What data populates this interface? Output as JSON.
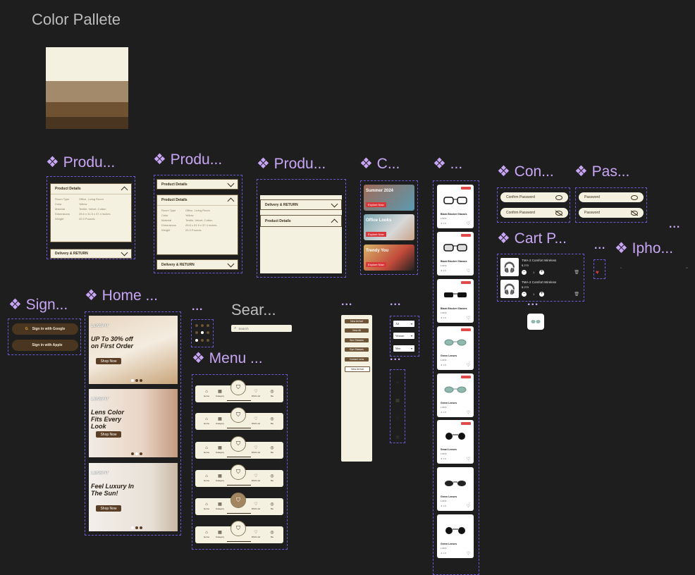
{
  "canvas": {
    "background": "#1e1e1e",
    "accent": "#c8a6f5"
  },
  "palette": {
    "title": "Color Pallete",
    "swatches": [
      "#f5f1e1",
      "#a38a6a",
      "#6e5232",
      "#4a3520"
    ]
  },
  "components": {
    "product1": "❖ Produ...",
    "product2": "❖ Produ...",
    "product3": "❖ Produ...",
    "c": "❖ C...",
    "dots1": "❖ ...",
    "confirm": "❖ Con...",
    "pass": "❖ Pas...",
    "cart": "❖ Cart P...",
    "iphone": "❖ Ipho...",
    "sign": "❖ Sign...",
    "home": "❖ Home ...",
    "menu": "❖ Menu ...",
    "search_title": "Sear...",
    "ellipsis": "..."
  },
  "product_details": {
    "header": "Product Details",
    "delivery": "Delivery & RETURN",
    "specs": [
      {
        "k": "Room Type",
        "v": "Office, Living Room"
      },
      {
        "k": "Color",
        "v": "Yellow"
      },
      {
        "k": "Material",
        "v": "Textile, Velvet, Cotton"
      },
      {
        "k": "Dimensions",
        "v": "25.6 x 31.5 x 37.4 inches"
      },
      {
        "k": "Weight",
        "v": "20.3 Pounds"
      }
    ]
  },
  "banners": [
    {
      "title": "Summer 2024",
      "btn": "Explore Now"
    },
    {
      "title": "Office Looks",
      "btn": "Explore Now"
    },
    {
      "title": "Trendy You",
      "btn": "Explore Now"
    }
  ],
  "products": [
    {
      "name": "Black Blocker Glasses",
      "price": "1.60 $",
      "rating": "★ 4.8"
    },
    {
      "name": "Black Blocker Glasses",
      "price": "1.60 $",
      "rating": "★ 4.8"
    },
    {
      "name": "Black Blocker Glasses",
      "price": "1.60 $",
      "rating": "★ 4.8"
    },
    {
      "name": "Green Lenses",
      "price": "1.60 $",
      "rating": "★ 4.8"
    },
    {
      "name": "Green Lenses",
      "price": "1.60 $",
      "rating": "★ 4.8"
    },
    {
      "name": "Smart Lenses",
      "price": "1.60 $",
      "rating": "★ 4.8"
    },
    {
      "name": "Green Lenses",
      "price": "1.60 $",
      "rating": "★ 4.8"
    },
    {
      "name": "Green Lenses",
      "price": "1.60 $",
      "rating": "★ 4.8"
    }
  ],
  "passwords": {
    "confirm1": "Confirm Password",
    "confirm2": "Confirm Password",
    "pass1": "Password",
    "pass2": "Password"
  },
  "cart": [
    {
      "name": "TMA-2 Comfort Wireless",
      "price": "$ 270",
      "qty": "1"
    },
    {
      "name": "TMA-2 Comfort Wireless",
      "price": "$ 270",
      "qty": "1"
    }
  ],
  "sign_in": {
    "google": "Sign in with Google",
    "apple": "Sign in with Apple"
  },
  "home": [
    {
      "brand": "LENSFIT",
      "headline": "UP To 30% off on First Order",
      "shop": "Shop Now"
    },
    {
      "brand": "LENSFIT",
      "headline": "Lens Color Fits Every Look",
      "shop": "Shop Now"
    },
    {
      "brand": "LENSFIT",
      "headline": "Feel Luxury In The Sun!",
      "shop": "Shop Now"
    }
  ],
  "search": {
    "placeholder": "Search"
  },
  "menu_items": [
    "New Arrival",
    "View All",
    "Sun Glasses",
    "Eye Glasses",
    "Contact Lens",
    "New Arrival"
  ],
  "selects": [
    "All",
    "Women",
    "Men"
  ],
  "nav": {
    "home": "Home",
    "category": "Category",
    "wishlist": "Wish List",
    "me": "Me"
  }
}
